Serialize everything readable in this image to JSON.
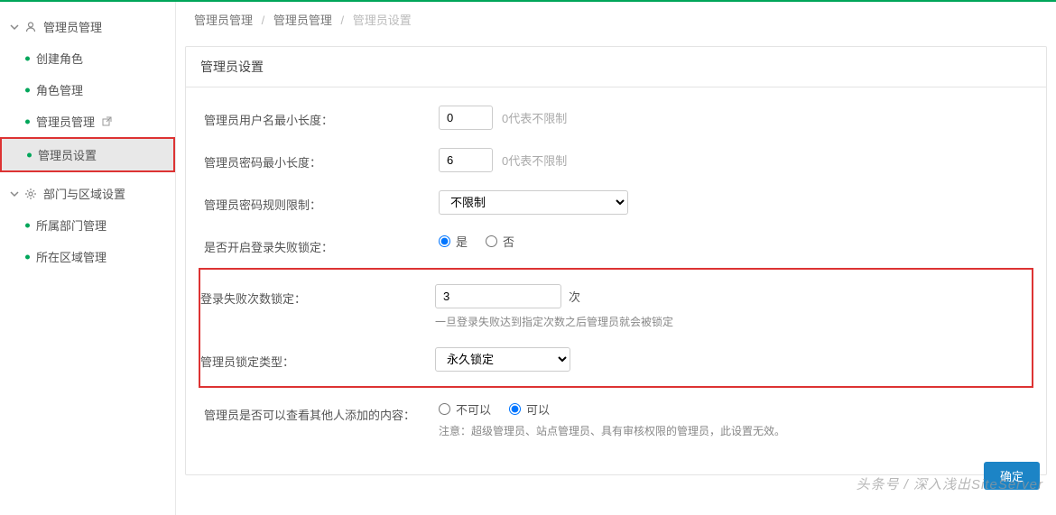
{
  "sidebar": {
    "groups": [
      {
        "title": "管理员管理",
        "items": [
          {
            "label": "创建角色"
          },
          {
            "label": "角色管理"
          },
          {
            "label": "管理员管理",
            "ext": true
          },
          {
            "label": "管理员设置",
            "selected": true,
            "boxed": true
          }
        ]
      },
      {
        "title": "部门与区域设置",
        "items": [
          {
            "label": "所属部门管理"
          },
          {
            "label": "所在区域管理"
          }
        ]
      }
    ]
  },
  "breadcrumb": {
    "a": "管理员管理",
    "b": "管理员管理",
    "c": "管理员设置"
  },
  "panel": {
    "title": "管理员设置"
  },
  "form": {
    "usernameMin": {
      "label": "管理员用户名最小长度：",
      "value": "0",
      "hint": "0代表不限制"
    },
    "passwordMin": {
      "label": "管理员密码最小长度：",
      "value": "6",
      "hint": "0代表不限制"
    },
    "passwordRule": {
      "label": "管理员密码规则限制：",
      "value": "不限制"
    },
    "loginFailLock": {
      "label": "是否开启登录失败锁定：",
      "yes": "是",
      "no": "否"
    },
    "failCount": {
      "label": "登录失败次数锁定：",
      "value": "3",
      "unit": "次",
      "sub": "一旦登录失败达到指定次数之后管理员就会被锁定"
    },
    "lockType": {
      "label": "管理员锁定类型：",
      "value": "永久锁定"
    },
    "viewOthers": {
      "label": "管理员是否可以查看其他人添加的内容：",
      "opt1": "不可以",
      "opt2": "可以",
      "sub": "注意：超级管理员、站点管理员、具有审核权限的管理员，此设置无效。"
    }
  },
  "buttons": {
    "submit": "确定"
  },
  "watermark": "头条号 / 深入浅出SiteServer"
}
